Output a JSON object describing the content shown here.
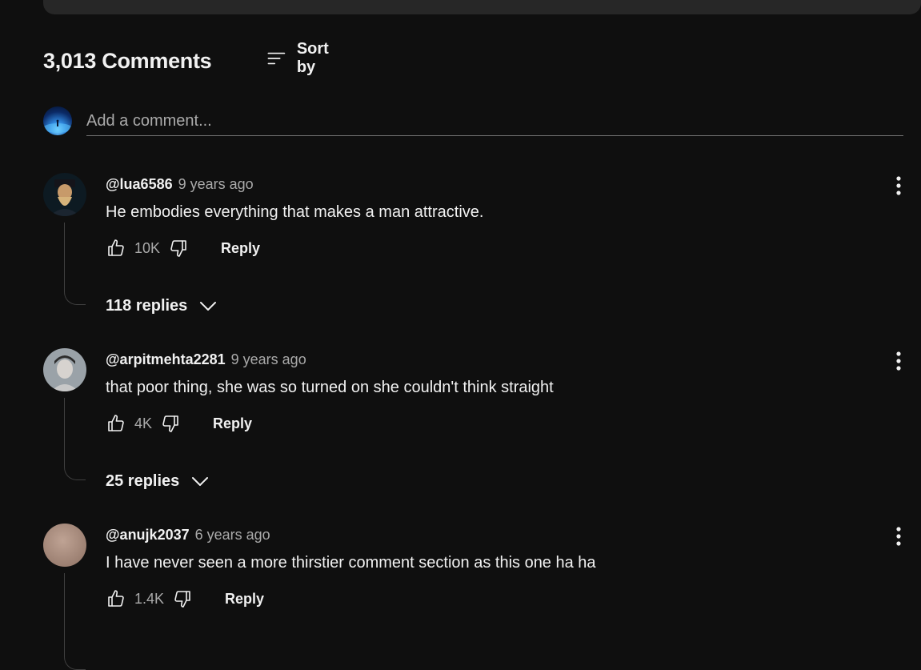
{
  "header": {
    "comment_count": "3,013 Comments",
    "sort_label": "Sort by"
  },
  "add_comment": {
    "placeholder": "Add a comment..."
  },
  "comments": [
    {
      "author": "@lua6586",
      "time": "9 years ago",
      "text": "He embodies everything that makes a man attractive.",
      "likes": "10K",
      "reply_label": "Reply",
      "replies_label": "118 replies"
    },
    {
      "author": "@arpitmehta2281",
      "time": "9 years ago",
      "text": "that poor thing, she was so turned on she couldn't think straight",
      "likes": "4K",
      "reply_label": "Reply",
      "replies_label": "25 replies"
    },
    {
      "author": "@anujk2037",
      "time": "6 years ago",
      "text": "I have never seen a more thirstier comment section as this one ha ha",
      "likes": "1.4K",
      "reply_label": "Reply"
    }
  ],
  "icons": {
    "sort": "sort-icon",
    "like": "thumbs-up-icon",
    "dislike": "thumbs-down-icon",
    "more": "more-vertical-icon",
    "expand": "chevron-down-icon"
  },
  "colors": {
    "background": "#0f0f0f",
    "text_primary": "#f1f1f1",
    "text_secondary": "#aaaaaa"
  }
}
